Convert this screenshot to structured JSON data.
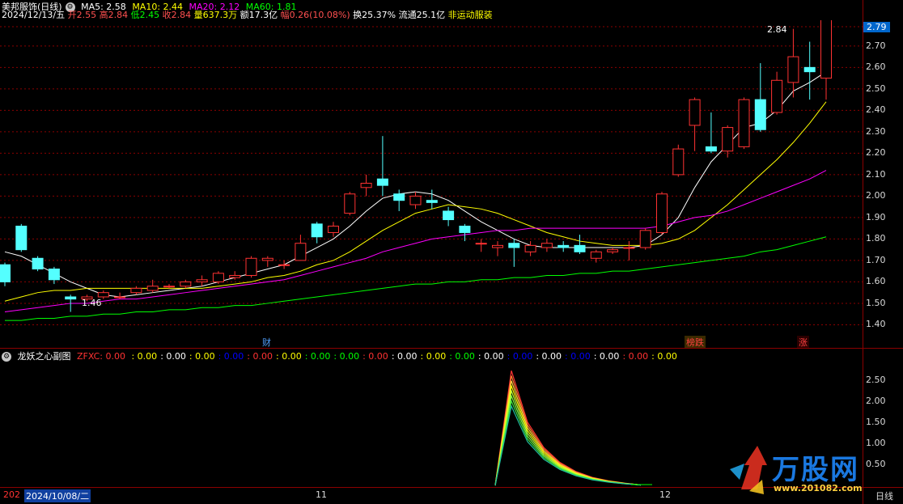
{
  "main_header": {
    "title": "美邦服饰(日线)",
    "ma5": "MA5: 2.58",
    "ma10": "MA10: 2.44",
    "ma20": "MA20: 2.12",
    "ma60": "MA60: 1.81"
  },
  "quote": {
    "date": "2024/12/13/五",
    "open": "开2.55",
    "high": "高2.84",
    "low": "低2.45",
    "close": "收2.84",
    "volume": "量637.3万",
    "amount": "额17.3亿",
    "change": "幅0.26(10.08%)",
    "turnover": "换25.37%",
    "float": "流通25.1亿",
    "sector": "非运动服装"
  },
  "price_axis": {
    "labels": [
      "2.79",
      "2.70",
      "2.60",
      "2.50",
      "2.40",
      "2.30",
      "2.20",
      "2.10",
      "2.00",
      "1.90",
      "1.80",
      "1.70",
      "1.60",
      "1.50",
      "1.40"
    ],
    "current": "2.79"
  },
  "annotations": {
    "high_mark": "2.84",
    "low_mark": "1.46",
    "event_cai": "财",
    "event_bang": "榜跌",
    "event_zhang": "涨"
  },
  "sub_header": {
    "title": "龙妖之心副图",
    "indicator": "ZFXC: 0.00",
    "values": [
      ": 0.00",
      ": 0.00",
      ": 0.00",
      ": 0.00",
      ": 0.00",
      ": 0.00",
      ": 0.00",
      ": 0.00",
      ": 0.00",
      ": 0.00",
      ": 0.00",
      ": 0.00",
      ": 0.00",
      ": 0.00",
      ": 0.00",
      ": 0.00",
      ": 0.00",
      ": 0.00",
      ": 0.00"
    ]
  },
  "sub_axis": {
    "labels": [
      "2.50",
      "2.00",
      "1.50",
      "1.00",
      "0.50"
    ]
  },
  "timeline": {
    "left_stub": "202",
    "cursor_date": "2024/10/08/二",
    "month_11": "11",
    "month_12": "12",
    "period": "日线"
  },
  "logo": {
    "text": "万股网",
    "url": "www.201082.com"
  },
  "colors": {
    "up": "#ff3232",
    "down": "#54ffff",
    "ma5": "#ffffff",
    "ma10": "#ffff00",
    "ma20": "#ff00ff",
    "ma60": "#00ff00",
    "grid": "#8b0000"
  },
  "candles": [
    [
      1.68,
      1.6,
      1.69,
      1.58
    ],
    [
      1.86,
      1.75,
      1.87,
      1.74
    ],
    [
      1.71,
      1.66,
      1.72,
      1.65
    ],
    [
      1.66,
      1.61,
      1.67,
      1.59
    ],
    [
      1.53,
      1.52,
      1.54,
      1.46
    ],
    [
      1.52,
      1.53,
      1.54,
      1.51
    ],
    [
      1.53,
      1.55,
      1.56,
      1.52
    ],
    [
      1.53,
      1.53,
      1.55,
      1.52
    ],
    [
      1.55,
      1.57,
      1.58,
      1.54
    ],
    [
      1.56,
      1.58,
      1.61,
      1.55
    ],
    [
      1.58,
      1.58,
      1.59,
      1.57
    ],
    [
      1.58,
      1.6,
      1.61,
      1.57
    ],
    [
      1.6,
      1.61,
      1.63,
      1.58
    ],
    [
      1.6,
      1.64,
      1.65,
      1.59
    ],
    [
      1.62,
      1.63,
      1.65,
      1.61
    ],
    [
      1.63,
      1.71,
      1.72,
      1.62
    ],
    [
      1.7,
      1.71,
      1.72,
      1.67
    ],
    [
      1.68,
      1.68,
      1.7,
      1.66
    ],
    [
      1.7,
      1.78,
      1.82,
      1.7
    ],
    [
      1.87,
      1.81,
      1.88,
      1.78
    ],
    [
      1.83,
      1.86,
      1.88,
      1.81
    ],
    [
      1.92,
      2.01,
      2.02,
      1.91
    ],
    [
      2.04,
      2.06,
      2.1,
      2.0
    ],
    [
      2.08,
      2.05,
      2.28,
      2.0
    ],
    [
      2.01,
      1.98,
      2.03,
      1.93
    ],
    [
      1.96,
      2.0,
      2.02,
      1.94
    ],
    [
      1.98,
      1.97,
      2.03,
      1.94
    ],
    [
      1.93,
      1.89,
      1.95,
      1.86
    ],
    [
      1.86,
      1.83,
      1.87,
      1.79
    ],
    [
      1.78,
      1.78,
      1.8,
      1.74
    ],
    [
      1.76,
      1.77,
      1.79,
      1.72
    ],
    [
      1.78,
      1.76,
      1.8,
      1.67
    ],
    [
      1.74,
      1.77,
      1.79,
      1.72
    ],
    [
      1.76,
      1.78,
      1.8,
      1.74
    ],
    [
      1.77,
      1.76,
      1.79,
      1.74
    ],
    [
      1.77,
      1.74,
      1.82,
      1.73
    ],
    [
      1.71,
      1.74,
      1.75,
      1.69
    ],
    [
      1.74,
      1.75,
      1.76,
      1.73
    ],
    [
      1.76,
      1.76,
      1.79,
      1.7
    ],
    [
      1.76,
      1.84,
      1.85,
      1.75
    ],
    [
      1.83,
      2.01,
      2.02,
      1.82
    ],
    [
      2.1,
      2.22,
      2.24,
      2.09
    ],
    [
      2.33,
      2.45,
      2.46,
      2.21
    ],
    [
      2.23,
      2.21,
      2.39,
      2.2
    ],
    [
      2.21,
      2.32,
      2.33,
      2.18
    ],
    [
      2.23,
      2.45,
      2.46,
      2.22
    ],
    [
      2.45,
      2.31,
      2.62,
      2.3
    ],
    [
      2.39,
      2.54,
      2.58,
      2.38
    ],
    [
      2.53,
      2.65,
      2.78,
      2.46
    ],
    [
      2.6,
      2.58,
      2.72,
      2.45
    ],
    [
      2.55,
      2.84,
      2.84,
      2.45
    ]
  ],
  "ma_points": {
    "ma5": [
      1.74,
      1.72,
      1.68,
      1.64,
      1.6,
      1.57,
      1.54,
      1.53,
      1.54,
      1.55,
      1.56,
      1.57,
      1.58,
      1.6,
      1.62,
      1.64,
      1.66,
      1.68,
      1.72,
      1.76,
      1.8,
      1.86,
      1.93,
      1.99,
      2.01,
      2.02,
      2.01,
      1.98,
      1.93,
      1.88,
      1.84,
      1.8,
      1.77,
      1.76,
      1.76,
      1.76,
      1.76,
      1.76,
      1.76,
      1.77,
      1.82,
      1.9,
      2.04,
      2.16,
      2.24,
      2.32,
      2.34,
      2.4,
      2.49,
      2.53,
      2.58
    ],
    "ma10": [
      1.51,
      1.53,
      1.55,
      1.56,
      1.56,
      1.57,
      1.57,
      1.57,
      1.57,
      1.57,
      1.57,
      1.57,
      1.57,
      1.58,
      1.59,
      1.6,
      1.62,
      1.63,
      1.65,
      1.68,
      1.7,
      1.74,
      1.79,
      1.84,
      1.88,
      1.92,
      1.94,
      1.96,
      1.95,
      1.94,
      1.92,
      1.89,
      1.86,
      1.83,
      1.81,
      1.79,
      1.78,
      1.77,
      1.77,
      1.77,
      1.78,
      1.8,
      1.84,
      1.9,
      1.96,
      2.03,
      2.1,
      2.17,
      2.25,
      2.34,
      2.44
    ],
    "ma20": [
      1.46,
      1.47,
      1.48,
      1.49,
      1.5,
      1.5,
      1.51,
      1.52,
      1.52,
      1.53,
      1.54,
      1.55,
      1.56,
      1.57,
      1.58,
      1.59,
      1.6,
      1.61,
      1.63,
      1.65,
      1.67,
      1.69,
      1.71,
      1.74,
      1.76,
      1.78,
      1.8,
      1.81,
      1.82,
      1.83,
      1.84,
      1.84,
      1.85,
      1.85,
      1.85,
      1.85,
      1.85,
      1.85,
      1.85,
      1.85,
      1.86,
      1.88,
      1.9,
      1.91,
      1.93,
      1.96,
      1.99,
      2.02,
      2.05,
      2.08,
      2.12
    ],
    "ma60": [
      1.42,
      1.42,
      1.43,
      1.43,
      1.44,
      1.44,
      1.45,
      1.45,
      1.46,
      1.46,
      1.47,
      1.47,
      1.48,
      1.48,
      1.49,
      1.49,
      1.5,
      1.51,
      1.52,
      1.53,
      1.54,
      1.55,
      1.56,
      1.57,
      1.58,
      1.59,
      1.59,
      1.6,
      1.6,
      1.61,
      1.61,
      1.62,
      1.62,
      1.63,
      1.63,
      1.64,
      1.64,
      1.65,
      1.65,
      1.66,
      1.67,
      1.68,
      1.69,
      1.7,
      1.71,
      1.72,
      1.74,
      1.75,
      1.77,
      1.79,
      1.81
    ]
  }
}
